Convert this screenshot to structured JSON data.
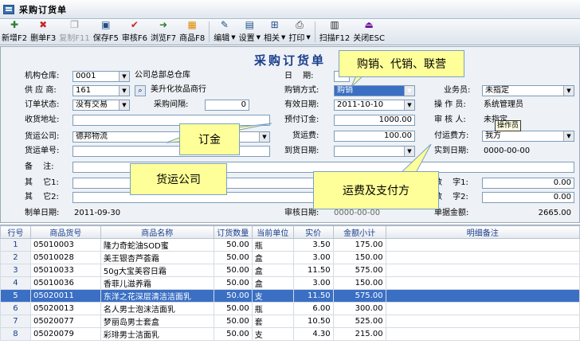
{
  "window": {
    "title": "采购订货单"
  },
  "toolbar": [
    {
      "key": "new",
      "label": "新增F2",
      "icon": "new-doc-icon",
      "glyph": "✚",
      "color": "#2e7d32",
      "disabled": false
    },
    {
      "key": "delete",
      "label": "删单F3",
      "icon": "delete-x-icon",
      "glyph": "✖",
      "color": "#c62828",
      "disabled": false
    },
    {
      "key": "copy",
      "label": "复制F11",
      "icon": "copy-icon",
      "glyph": "❐",
      "color": "#9a9a9a",
      "disabled": true
    },
    {
      "key": "save",
      "label": "保存F5",
      "icon": "save-disk-icon",
      "glyph": "▣",
      "color": "#1f4d86",
      "disabled": false
    },
    {
      "key": "audit",
      "label": "审核F6",
      "icon": "audit-check-icon",
      "glyph": "✔",
      "color": "#c62828",
      "disabled": false
    },
    {
      "key": "browse",
      "label": "浏览F7",
      "icon": "browse-arrow-icon",
      "glyph": "➜",
      "color": "#2e7d32",
      "disabled": false
    },
    {
      "key": "product",
      "label": "商品F8",
      "icon": "product-grid-icon",
      "glyph": "▦",
      "color": "#e08a00",
      "disabled": false
    },
    {
      "key": "edit",
      "label": "编辑",
      "icon": "edit-pencil-icon",
      "glyph": "✎",
      "color": "#1f4d86",
      "disabled": false,
      "dropdown": true
    },
    {
      "key": "settings",
      "label": "设置",
      "icon": "settings-window-icon",
      "glyph": "▤",
      "color": "#1f4d86",
      "disabled": false,
      "dropdown": true
    },
    {
      "key": "related",
      "label": "相关",
      "icon": "related-tree-icon",
      "glyph": "⊞",
      "color": "#1f4d86",
      "disabled": false,
      "dropdown": true
    },
    {
      "key": "print",
      "label": "打印",
      "icon": "printer-icon",
      "glyph": "⎙",
      "color": "#333333",
      "disabled": false,
      "dropdown": true
    },
    {
      "key": "scan",
      "label": "扫描F12",
      "icon": "barcode-icon",
      "glyph": "▥",
      "color": "#222222",
      "disabled": false
    },
    {
      "key": "close",
      "label": "关闭ESC",
      "icon": "close-door-icon",
      "glyph": "⏏",
      "color": "#6a1b9a",
      "disabled": false
    }
  ],
  "form": {
    "title": "采购订货单",
    "warehouse_label": "机构仓库:",
    "warehouse_code": "0001",
    "warehouse_name": "公司总部总仓库",
    "supplier_label": "供 应 商:",
    "supplier_code": "161",
    "supplier_name": "美升化妆品商行",
    "status_label": "订单状态:",
    "status_value": "没有交易",
    "interval_label": "采购间隔:",
    "interval_value": "0",
    "address_label": "收货地址:",
    "address_value": "",
    "freight_company_label": "货运公司:",
    "freight_company_value": "德邦物流",
    "freight_no_label": "货运单号:",
    "freight_no_value": "",
    "remark_label": "备　 注:",
    "remark_value": "",
    "other1_label": "其　 它1:",
    "other1_value": "",
    "other2_label": "其　 它2:",
    "other2_value": "",
    "created_label": "制单日期:",
    "created_value": "2011-09-30",
    "date_label": "日　 期:",
    "method_label": "购销方式:",
    "method_value": "购销",
    "valid_label": "有效日期:",
    "valid_value": "2011-10-10",
    "deposit_label": "预付订金:",
    "deposit_value": "1000.00",
    "shipping_fee_label": "货运费:",
    "shipping_fee_value": "100.00",
    "arrival_label": "到货日期:",
    "arrival_value": "",
    "audit_date_label": "审核日期:",
    "audit_date_value": "0000-00-00",
    "salesman_label": "业务员:",
    "salesman_value": "未指定",
    "operator_label": "操 作 员:",
    "operator_value": "系统管理员",
    "auditor_label": "审 核 人:",
    "auditor_value": "未指定",
    "payer_label": "付运费方:",
    "payer_value": "我方",
    "actual_arrival_label": "实到日期:",
    "actual_arrival_value": "0000-00-00",
    "number1_label": "数　 字1:",
    "number1_value": "0.00",
    "number2_label": "数　 字2:",
    "number2_value": "0.00",
    "amount_label": "单据金额:",
    "amount_value": "2665.00"
  },
  "callouts": {
    "purchase_method": "购销、代销、联营",
    "deposit": "订金",
    "freight_company": "货运公司",
    "shipping": "运费及支付方"
  },
  "tooltip": "操作员",
  "grid": {
    "headers": [
      "行号",
      "商品货号",
      "商品名称",
      "订货数量",
      "当前单位",
      "实价",
      "金额小计",
      "明细备注"
    ],
    "rows": [
      [
        "1",
        "05010003",
        "隆力奇蛇油SOD蜜",
        "50.00",
        "瓶",
        "3.50",
        "175.00",
        ""
      ],
      [
        "2",
        "05010028",
        "美王银杏芦荟霜",
        "50.00",
        "盒",
        "3.00",
        "150.00",
        ""
      ],
      [
        "3",
        "05010033",
        "50g大宝美容日霜",
        "50.00",
        "盒",
        "11.50",
        "575.00",
        ""
      ],
      [
        "4",
        "05010036",
        "香菲儿滋养霜",
        "50.00",
        "盒",
        "3.00",
        "150.00",
        ""
      ],
      [
        "5",
        "05020011",
        "东洋之花深层清洁洁面乳",
        "50.00",
        "支",
        "11.50",
        "575.00",
        ""
      ],
      [
        "6",
        "05020013",
        "名人男士泡沫洁面乳",
        "50.00",
        "瓶",
        "6.00",
        "300.00",
        ""
      ],
      [
        "7",
        "05020077",
        "梦丽岛男士套盒",
        "50.00",
        "套",
        "10.50",
        "525.00",
        ""
      ],
      [
        "8",
        "05020079",
        "彩琲男士洁面乳",
        "50.00",
        "支",
        "4.30",
        "215.00",
        ""
      ]
    ],
    "selected_row": 4
  }
}
